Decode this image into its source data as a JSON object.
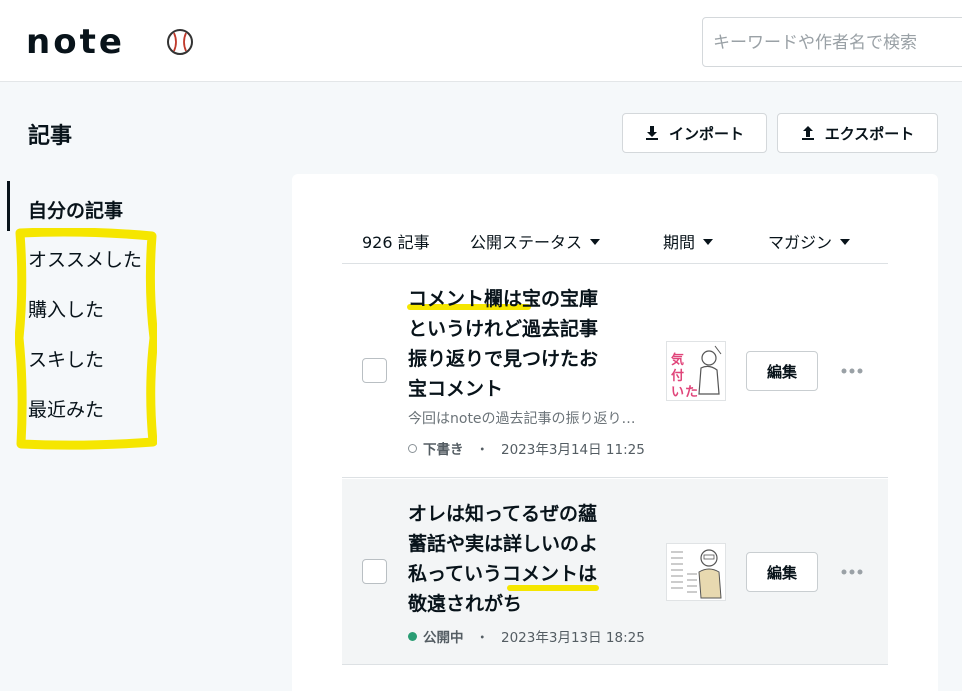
{
  "header": {
    "logo_text": "note",
    "search_placeholder": "キーワードや作者名で検索"
  },
  "page": {
    "title": "記事",
    "import_label": "インポート",
    "export_label": "エクスポート"
  },
  "sidebar": {
    "items": [
      {
        "label": "自分の記事",
        "active": true
      },
      {
        "label": "オススメした"
      },
      {
        "label": "購入した"
      },
      {
        "label": "スキした"
      },
      {
        "label": "最近みた"
      }
    ]
  },
  "filters": {
    "count": "926 記事",
    "status": "公開ステータス",
    "period": "期間",
    "magazine": "マガジン"
  },
  "articles": [
    {
      "title_lines": [
        "コメント欄は宝の宝庫",
        "というけれど過去記事",
        "振り返りで見つけたお",
        "宝コメント"
      ],
      "excerpt": "今回はnoteの過去記事の振り返り…",
      "status": "下書き",
      "separator": "・",
      "date": "2023年3月14日 11:25",
      "edit_label": "編集",
      "thumb_text": "気付いた"
    },
    {
      "title_lines": [
        "オレは知ってるぜの蘊",
        "蓄話や実は詳しいのよ",
        "私っていうコメントは",
        "敬遠されがち"
      ],
      "status": "公開中",
      "separator": "・",
      "date": "2023年3月13日 18:25",
      "edit_label": "編集"
    }
  ],
  "colors": {
    "highlight": "#f5e600",
    "public_status": "#2a9d74",
    "background": "#f5f8fa"
  }
}
